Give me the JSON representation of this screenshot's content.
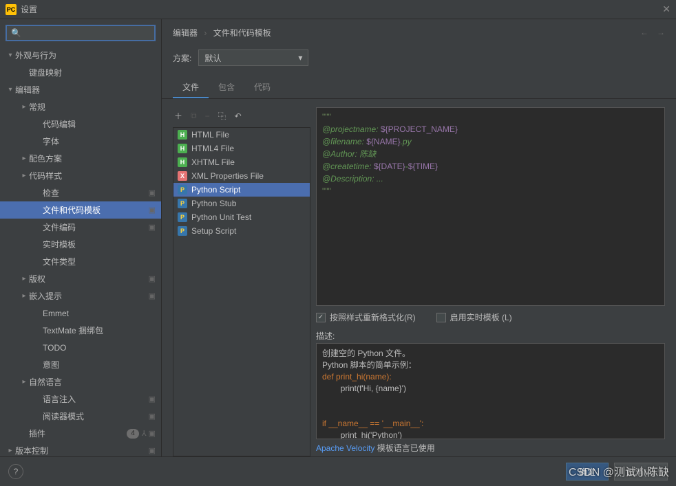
{
  "window": {
    "icon_text": "PC",
    "title": "设置"
  },
  "search": {
    "placeholder": ""
  },
  "sidebar": {
    "items": [
      {
        "label": "外观与行为",
        "arrow": "▾",
        "depth": 0
      },
      {
        "label": "键盘映射",
        "arrow": "",
        "depth": 1
      },
      {
        "label": "编辑器",
        "arrow": "▾",
        "depth": 0
      },
      {
        "label": "常规",
        "arrow": "▸",
        "depth": 1
      },
      {
        "label": "代码编辑",
        "arrow": "",
        "depth": 2
      },
      {
        "label": "字体",
        "arrow": "",
        "depth": 2
      },
      {
        "label": "配色方案",
        "arrow": "▸",
        "depth": 1
      },
      {
        "label": "代码样式",
        "arrow": "▸",
        "depth": 1
      },
      {
        "label": "检查",
        "arrow": "",
        "depth": 2,
        "meta": "▣"
      },
      {
        "label": "文件和代码模板",
        "arrow": "",
        "depth": 2,
        "selected": true,
        "meta": "▣"
      },
      {
        "label": "文件编码",
        "arrow": "",
        "depth": 2,
        "meta": "▣"
      },
      {
        "label": "实时模板",
        "arrow": "",
        "depth": 2
      },
      {
        "label": "文件类型",
        "arrow": "",
        "depth": 2
      },
      {
        "label": "版权",
        "arrow": "▸",
        "depth": 1,
        "meta": "▣"
      },
      {
        "label": "嵌入提示",
        "arrow": "▸",
        "depth": 1,
        "meta": "▣"
      },
      {
        "label": "Emmet",
        "arrow": "",
        "depth": 2
      },
      {
        "label": "TextMate 捆绑包",
        "arrow": "",
        "depth": 2
      },
      {
        "label": "TODO",
        "arrow": "",
        "depth": 2
      },
      {
        "label": "意图",
        "arrow": "",
        "depth": 2
      },
      {
        "label": "自然语言",
        "arrow": "▸",
        "depth": 1
      },
      {
        "label": "语言注入",
        "arrow": "",
        "depth": 2,
        "meta": "▣"
      },
      {
        "label": "阅读器模式",
        "arrow": "",
        "depth": 2,
        "meta": "▣"
      },
      {
        "label": "插件",
        "arrow": "",
        "depth": 1,
        "badge": "4",
        "meta": "⅄ ▣"
      },
      {
        "label": "版本控制",
        "arrow": "▸",
        "depth": 0,
        "meta": "▣"
      }
    ]
  },
  "breadcrumb": {
    "a": "编辑器",
    "b": "文件和代码模板"
  },
  "scheme": {
    "label": "方案:",
    "value": "默认"
  },
  "tabs": [
    {
      "label": "文件",
      "active": true
    },
    {
      "label": "包含",
      "active": false
    },
    {
      "label": "代码",
      "active": false
    }
  ],
  "files": [
    {
      "label": "HTML File",
      "icon": "html"
    },
    {
      "label": "HTML4 File",
      "icon": "html"
    },
    {
      "label": "XHTML File",
      "icon": "html"
    },
    {
      "label": "XML Properties File",
      "icon": "xml"
    },
    {
      "label": "Python Script",
      "icon": "py",
      "selected": true
    },
    {
      "label": "Python Stub",
      "icon": "py"
    },
    {
      "label": "Python Unit Test",
      "icon": "py"
    },
    {
      "label": "Setup Script",
      "icon": "py"
    }
  ],
  "template": {
    "l0": "\"\"\"",
    "l1a": "@projectname: ",
    "l1b": "${PROJECT_NAME}",
    "l2a": "@filename: ",
    "l2b": "${NAME}",
    "l2c": ".py",
    "l3a": "@Author: ",
    "l3b": "陈缺",
    "l4a": "@createtime: ",
    "l4b": "${DATE}",
    "l4c": "-",
    "l4d": "${TIME}",
    "l5a": "@Description: ",
    "l5b": "...",
    "l6": "\"\"\""
  },
  "checkboxes": {
    "reformat": "按照样式重新格式化(R)",
    "live": "启用实时模板 (L)"
  },
  "description": {
    "label": "描述:",
    "line1": "创建空的 Python 文件。",
    "line2": "Python 脚本的简单示例：",
    "line3": "def print_hi(name):",
    "line4": "        print(f'Hi, {name}')",
    "line5": "",
    "line6": "",
    "line7": "if __name__ == '__main__':",
    "line8": "        print_hi('Python')"
  },
  "velocity": {
    "link": "Apache Velocity",
    "text": " 模板语言已使用"
  },
  "footer": {
    "ok": "确定",
    "cancel": "取消(A)"
  },
  "watermark": "CSDN @测试小陈缺"
}
